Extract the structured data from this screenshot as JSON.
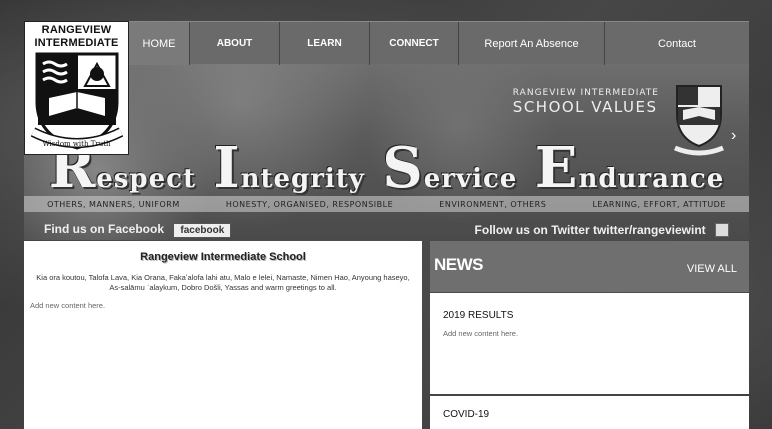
{
  "school": {
    "name_line1": "RANGEVIEW",
    "name_line2": "INTERMEDIATE",
    "motto": "Wisdom with Truth"
  },
  "nav": {
    "items": [
      {
        "label": "HOME"
      },
      {
        "label": "ABOUT"
      },
      {
        "label": "LEARN"
      },
      {
        "label": "CONNECT"
      },
      {
        "label": "Report An Absence"
      },
      {
        "label": "Contact"
      }
    ]
  },
  "banner": {
    "values_line1": "RANGEVIEW INTERMEDIATE",
    "values_line2": "SCHOOL VALUES",
    "values": [
      {
        "cap": "R",
        "rest": "espect"
      },
      {
        "cap": "I",
        "rest": "ntegrity"
      },
      {
        "cap": "S",
        "rest": "ervice"
      },
      {
        "cap": "E",
        "rest": "ndurance"
      }
    ],
    "subtexts": [
      "OTHERS, MANNERS, UNIFORM",
      "HONESTY, ORGANISED, RESPONSIBLE",
      "ENVIRONMENT, OTHERS",
      "LEARNING, EFFORT, ATTITUDE"
    ],
    "facebook_text": "Find us on Facebook",
    "facebook_badge": "facebook",
    "twitter_text": "Follow us on Twitter twitter/rangeviewint",
    "prev_arrow": "‹",
    "next_arrow": "›"
  },
  "welcome": {
    "title": "Rangeview Intermediate School",
    "greeting": "Kia ora koutou, Talofa Lava, Kia Orana, Fakaʻalofa lahi atu, Malo e lelei, Namaste, Nimen Hao, Anyoung haseyo, As-salāmu ʿalaykum, Dobro Došli, Yassas and warm greetings to all.",
    "placeholder": "Add new content here."
  },
  "news": {
    "title": "NEWS",
    "view_all": "VIEW ALL",
    "items": [
      {
        "title": "2019 RESULTS",
        "body": "Add new content here."
      },
      {
        "title": "COVID-19",
        "body": ""
      }
    ]
  },
  "colors": {
    "nav_bg": "#6a6a6a",
    "news_head_bg": "#6f6f6f",
    "panel_bg": "#ffffff"
  }
}
